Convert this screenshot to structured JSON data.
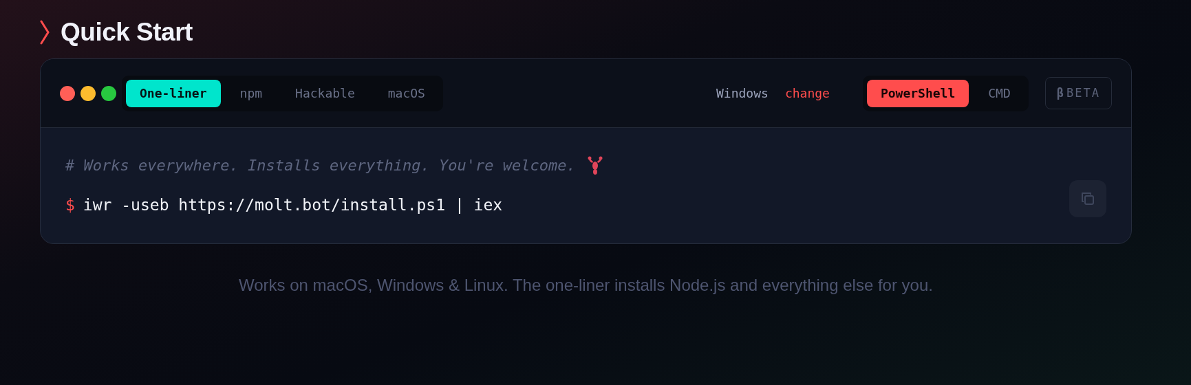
{
  "heading": {
    "title": "Quick Start"
  },
  "terminal": {
    "window_controls": [
      {
        "color": "#ff5f57"
      },
      {
        "color": "#febc2e"
      },
      {
        "color": "#28c840"
      }
    ],
    "tabs": [
      {
        "label": "One-liner",
        "selected": true
      },
      {
        "label": "npm",
        "selected": false
      },
      {
        "label": "Hackable",
        "selected": false
      },
      {
        "label": "macOS",
        "selected": false
      }
    ],
    "os": {
      "label": "Windows",
      "action": "change"
    },
    "shells": [
      {
        "label": "PowerShell",
        "selected": true
      },
      {
        "label": "CMD",
        "selected": false
      }
    ],
    "badge": {
      "symbol": "β",
      "label": "BETA"
    },
    "comment": "# Works everywhere. Installs everything. You're welcome.",
    "prompt": "$",
    "command": "iwr -useb https://molt.bot/install.ps1 | iex"
  },
  "footnote": "Works on macOS, Windows & Linux. The one-liner installs Node.js and everything else for you."
}
